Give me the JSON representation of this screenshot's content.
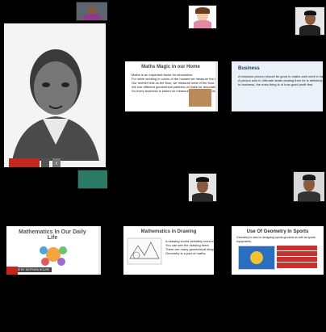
{
  "tiles": [
    {
      "id": "ramanujan",
      "title": ""
    },
    {
      "id": "maths-magic",
      "title": "Maths Magic in our Home",
      "bullets": [
        "Maths is an important factor for decoration.",
        "For while working in colors of the houses we measure the total surface area of walls.",
        "Our mother tells us the floor, we measure area of the floor.",
        "We use different geometrical patterns on walls for decoration.",
        "So every business is based on measure area rooms & Area."
      ]
    },
    {
      "id": "business",
      "title": "Business",
      "bullets": [
        "A business person should be good in maths and need to have a stock from teaching money without maths is not possible.",
        "A person who in Ultimate starts dealing then he is definitely going to be in loss.",
        "In business, the main thing is of how good profit first."
      ]
    },
    {
      "id": "daily-life",
      "title": "Mathematics In Our Daily Life",
      "badge": "MADE BY SATPURA HOUSE"
    },
    {
      "id": "drawing",
      "title": "Mathematics in Drawing",
      "bullets": [
        "A drawing would definitely need math",
        "You can see the drawing there",
        "There are many geometrical shapes present in it.",
        "Geometry is a part of maths."
      ]
    },
    {
      "id": "sports",
      "title": "Use Of Geometry In Sports",
      "caption": "Geometry is used in designing sports grounds as well as sports equipments."
    }
  ]
}
